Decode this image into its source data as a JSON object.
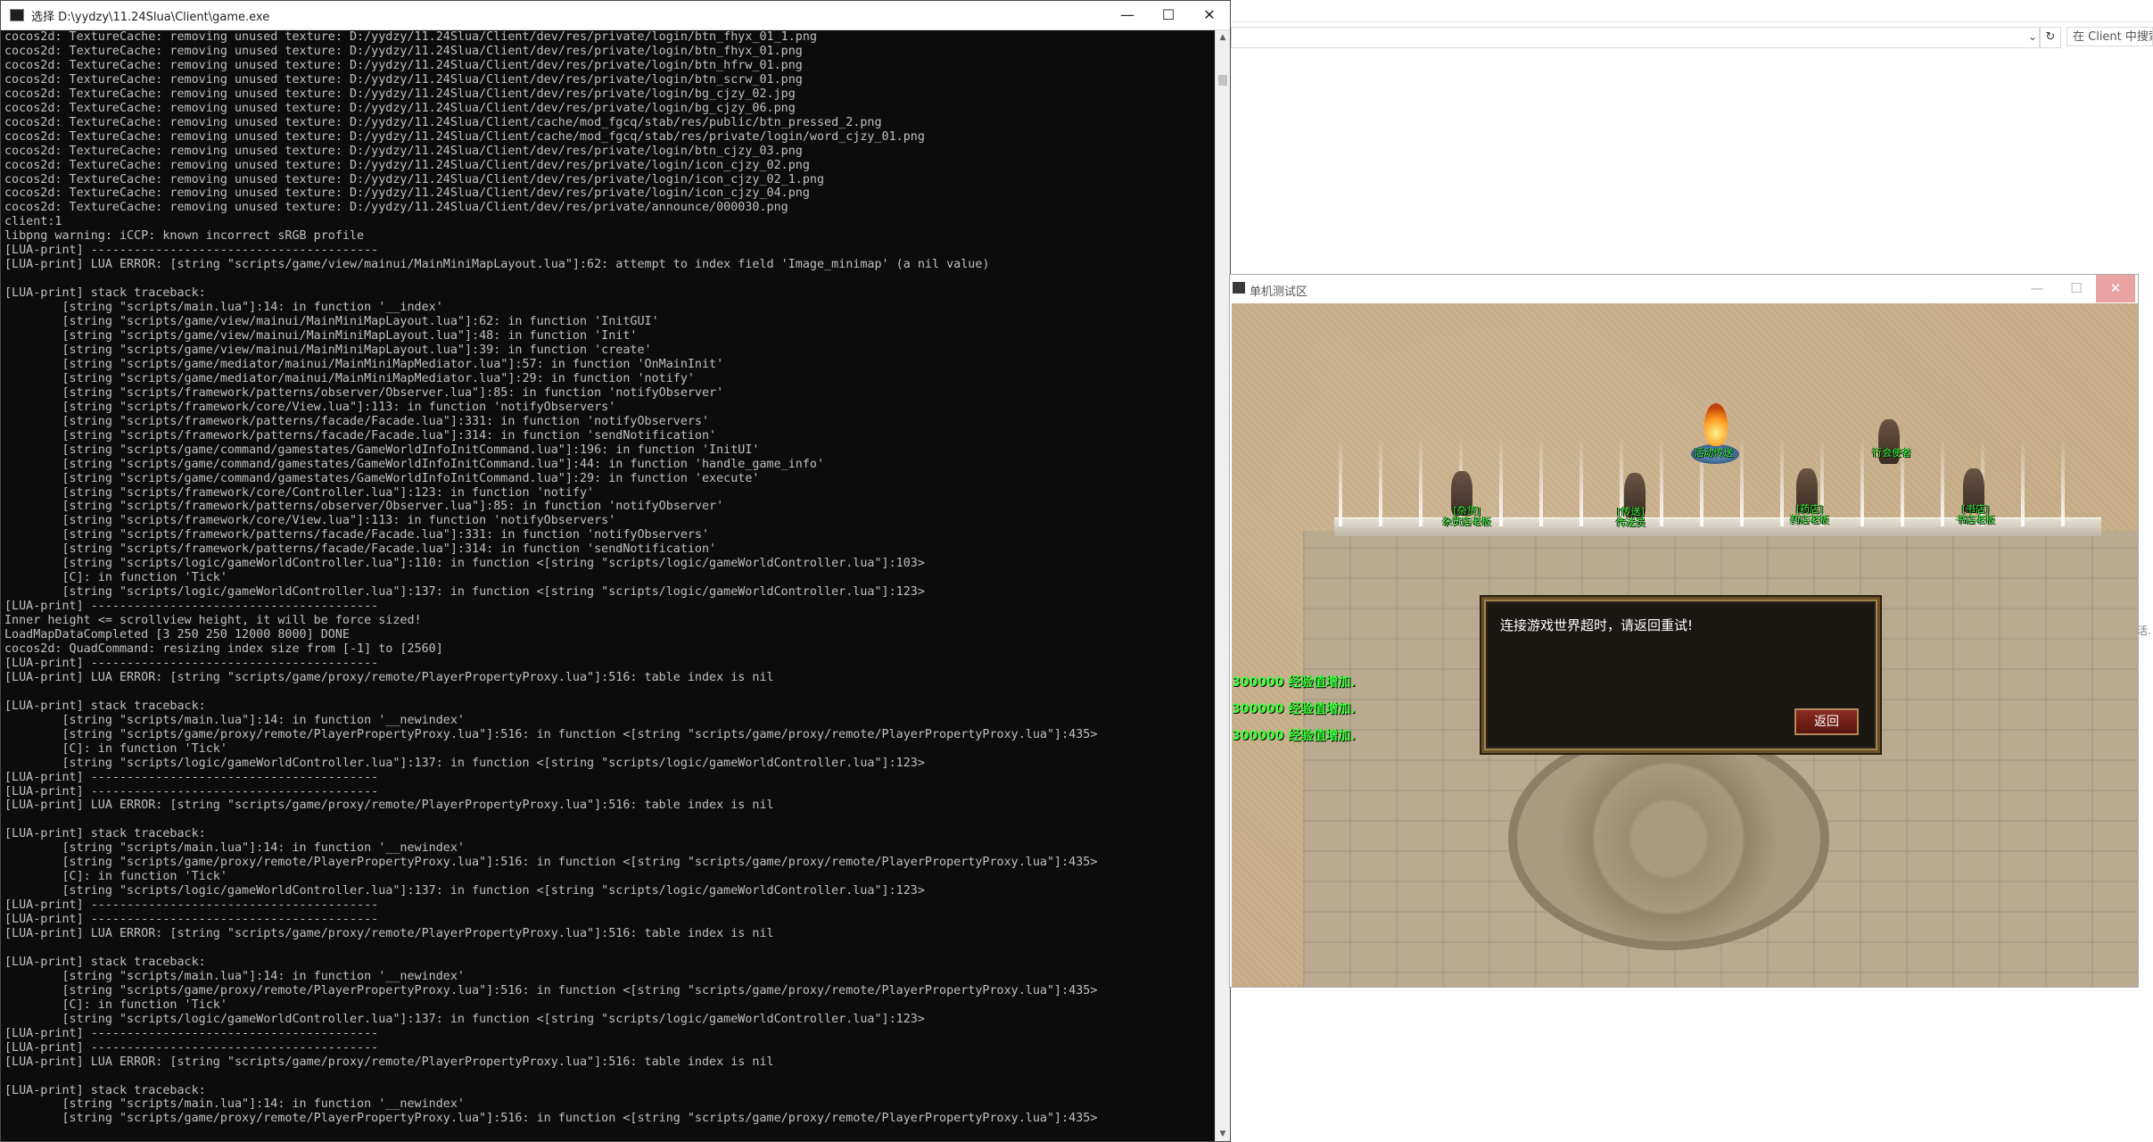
{
  "explorer": {
    "search_placeholder": "在 Client 中搜索",
    "refresh_icon": "↻",
    "chevron_icon": "⌄",
    "side_text": "活."
  },
  "console": {
    "title": "选择 D:\\yydzy\\11.24Slua\\Client\\game.exe",
    "minimize": "—",
    "maximize": "☐",
    "close": "✕",
    "lines": [
      "cocos2d: TextureCache: removing unused texture: D:/yydzy/11.24Slua/Client/dev/res/private/login/btn_fhyx_01_1.png",
      "cocos2d: TextureCache: removing unused texture: D:/yydzy/11.24Slua/Client/dev/res/private/login/btn_fhyx_01.png",
      "cocos2d: TextureCache: removing unused texture: D:/yydzy/11.24Slua/Client/dev/res/private/login/btn_hfrw_01.png",
      "cocos2d: TextureCache: removing unused texture: D:/yydzy/11.24Slua/Client/dev/res/private/login/btn_scrw_01.png",
      "cocos2d: TextureCache: removing unused texture: D:/yydzy/11.24Slua/Client/dev/res/private/login/bg_cjzy_02.jpg",
      "cocos2d: TextureCache: removing unused texture: D:/yydzy/11.24Slua/Client/dev/res/private/login/bg_cjzy_06.png",
      "cocos2d: TextureCache: removing unused texture: D:/yydzy/11.24Slua/Client/cache/mod_fgcq/stab/res/public/btn_pressed_2.png",
      "cocos2d: TextureCache: removing unused texture: D:/yydzy/11.24Slua/Client/cache/mod_fgcq/stab/res/private/login/word_cjzy_01.png",
      "cocos2d: TextureCache: removing unused texture: D:/yydzy/11.24Slua/Client/dev/res/private/login/btn_cjzy_03.png",
      "cocos2d: TextureCache: removing unused texture: D:/yydzy/11.24Slua/Client/dev/res/private/login/icon_cjzy_02.png",
      "cocos2d: TextureCache: removing unused texture: D:/yydzy/11.24Slua/Client/dev/res/private/login/icon_cjzy_02_1.png",
      "cocos2d: TextureCache: removing unused texture: D:/yydzy/11.24Slua/Client/dev/res/private/login/icon_cjzy_04.png",
      "cocos2d: TextureCache: removing unused texture: D:/yydzy/11.24Slua/Client/dev/res/private/announce/000030.png",
      "client:1",
      "libpng warning: iCCP: known incorrect sRGB profile",
      "[LUA-print] ----------------------------------------",
      "[LUA-print] LUA ERROR: [string \"scripts/game/view/mainui/MainMiniMapLayout.lua\"]:62: attempt to index field 'Image_minimap' (a nil value)",
      "",
      "[LUA-print] stack traceback:",
      "        [string \"scripts/main.lua\"]:14: in function '__index'",
      "        [string \"scripts/game/view/mainui/MainMiniMapLayout.lua\"]:62: in function 'InitGUI'",
      "        [string \"scripts/game/view/mainui/MainMiniMapLayout.lua\"]:48: in function 'Init'",
      "        [string \"scripts/game/view/mainui/MainMiniMapLayout.lua\"]:39: in function 'create'",
      "        [string \"scripts/game/mediator/mainui/MainMiniMapMediator.lua\"]:57: in function 'OnMainInit'",
      "        [string \"scripts/game/mediator/mainui/MainMiniMapMediator.lua\"]:29: in function 'notify'",
      "        [string \"scripts/framework/patterns/observer/Observer.lua\"]:85: in function 'notifyObserver'",
      "        [string \"scripts/framework/core/View.lua\"]:113: in function 'notifyObservers'",
      "        [string \"scripts/framework/patterns/facade/Facade.lua\"]:331: in function 'notifyObservers'",
      "        [string \"scripts/framework/patterns/facade/Facade.lua\"]:314: in function 'sendNotification'",
      "        [string \"scripts/game/command/gamestates/GameWorldInfoInitCommand.lua\"]:196: in function 'InitUI'",
      "        [string \"scripts/game/command/gamestates/GameWorldInfoInitCommand.lua\"]:44: in function 'handle_game_info'",
      "        [string \"scripts/game/command/gamestates/GameWorldInfoInitCommand.lua\"]:29: in function 'execute'",
      "        [string \"scripts/framework/core/Controller.lua\"]:123: in function 'notify'",
      "        [string \"scripts/framework/patterns/observer/Observer.lua\"]:85: in function 'notifyObserver'",
      "        [string \"scripts/framework/core/View.lua\"]:113: in function 'notifyObservers'",
      "        [string \"scripts/framework/patterns/facade/Facade.lua\"]:331: in function 'notifyObservers'",
      "        [string \"scripts/framework/patterns/facade/Facade.lua\"]:314: in function 'sendNotification'",
      "        [string \"scripts/logic/gameWorldController.lua\"]:110: in function <[string \"scripts/logic/gameWorldController.lua\"]:103>",
      "        [C]: in function 'Tick'",
      "        [string \"scripts/logic/gameWorldController.lua\"]:137: in function <[string \"scripts/logic/gameWorldController.lua\"]:123>",
      "[LUA-print] ----------------------------------------",
      "Inner height <= scrollview height, it will be force sized!",
      "LoadMapDataCompleted [3 250 250 12000 8000] DONE",
      "cocos2d: QuadCommand: resizing index size from [-1] to [2560]",
      "[LUA-print] ----------------------------------------",
      "[LUA-print] LUA ERROR: [string \"scripts/game/proxy/remote/PlayerPropertyProxy.lua\"]:516: table index is nil",
      "",
      "[LUA-print] stack traceback:",
      "        [string \"scripts/main.lua\"]:14: in function '__newindex'",
      "        [string \"scripts/game/proxy/remote/PlayerPropertyProxy.lua\"]:516: in function <[string \"scripts/game/proxy/remote/PlayerPropertyProxy.lua\"]:435>",
      "        [C]: in function 'Tick'",
      "        [string \"scripts/logic/gameWorldController.lua\"]:137: in function <[string \"scripts/logic/gameWorldController.lua\"]:123>",
      "[LUA-print] ----------------------------------------",
      "[LUA-print] ----------------------------------------",
      "[LUA-print] LUA ERROR: [string \"scripts/game/proxy/remote/PlayerPropertyProxy.lua\"]:516: table index is nil",
      "",
      "[LUA-print] stack traceback:",
      "        [string \"scripts/main.lua\"]:14: in function '__newindex'",
      "        [string \"scripts/game/proxy/remote/PlayerPropertyProxy.lua\"]:516: in function <[string \"scripts/game/proxy/remote/PlayerPropertyProxy.lua\"]:435>",
      "        [C]: in function 'Tick'",
      "        [string \"scripts/logic/gameWorldController.lua\"]:137: in function <[string \"scripts/logic/gameWorldController.lua\"]:123>",
      "[LUA-print] ----------------------------------------",
      "[LUA-print] ----------------------------------------",
      "[LUA-print] LUA ERROR: [string \"scripts/game/proxy/remote/PlayerPropertyProxy.lua\"]:516: table index is nil",
      "",
      "[LUA-print] stack traceback:",
      "        [string \"scripts/main.lua\"]:14: in function '__newindex'",
      "        [string \"scripts/game/proxy/remote/PlayerPropertyProxy.lua\"]:516: in function <[string \"scripts/game/proxy/remote/PlayerPropertyProxy.lua\"]:435>",
      "        [C]: in function 'Tick'",
      "        [string \"scripts/logic/gameWorldController.lua\"]:137: in function <[string \"scripts/logic/gameWorldController.lua\"]:123>",
      "[LUA-print] ----------------------------------------",
      "[LUA-print] ----------------------------------------",
      "[LUA-print] LUA ERROR: [string \"scripts/game/proxy/remote/PlayerPropertyProxy.lua\"]:516: table index is nil",
      "",
      "[LUA-print] stack traceback:",
      "        [string \"scripts/main.lua\"]:14: in function '__newindex'",
      "        [string \"scripts/game/proxy/remote/PlayerPropertyProxy.lua\"]:516: in function <[string \"scripts/game/proxy/remote/PlayerPropertyProxy.lua\"]:435>"
    ],
    "scroll_up": "▲",
    "scroll_down": "▼"
  },
  "game": {
    "title": "单机测试区",
    "minimize": "—",
    "maximize": "☐",
    "close": "✕",
    "npcs": [
      {
        "label": "[杂货]\n杂货店老板"
      },
      {
        "label": "[传送]\n传送员"
      },
      {
        "label": "活动传送"
      },
      {
        "label": "[药店]\n药店老板"
      },
      {
        "label": "行会使者"
      },
      {
        "label": "[书店]\n书店老板"
      }
    ],
    "exp_messages": [
      "300000 经验值增加.",
      "300000 经验值增加.",
      "300000 经验值增加."
    ],
    "dialog": {
      "message": "连接游戏世界超时，请返回重试!",
      "button": "返回"
    }
  }
}
